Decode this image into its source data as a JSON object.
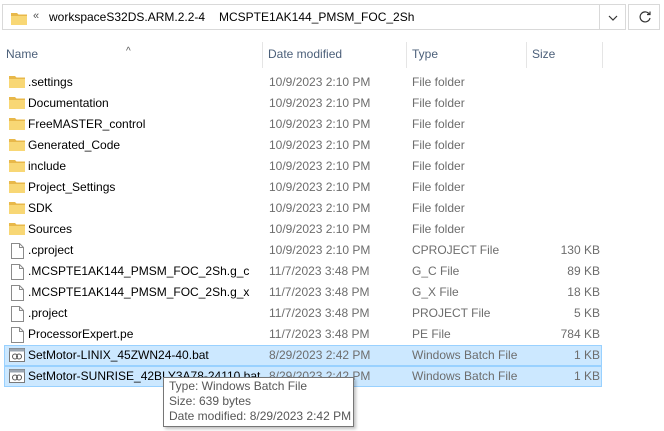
{
  "address_bar": {
    "chevron": "«",
    "segments": [
      "workspaceS32DS.ARM.2.2-4",
      "MCSPTE1AK144_PMSM_FOC_2Sh"
    ],
    "separator": "›"
  },
  "columns": {
    "name": "Name",
    "date": "Date modified",
    "type": "Type",
    "size": "Size",
    "sort_indicator": "^"
  },
  "files": [
    {
      "name": ".settings",
      "date": "10/9/2023 2:10 PM",
      "type": "File folder",
      "size": "",
      "icon": "folder-icon"
    },
    {
      "name": "Documentation",
      "date": "10/9/2023 2:10 PM",
      "type": "File folder",
      "size": "",
      "icon": "folder-icon"
    },
    {
      "name": "FreeMASTER_control",
      "date": "10/9/2023 2:10 PM",
      "type": "File folder",
      "size": "",
      "icon": "folder-icon"
    },
    {
      "name": "Generated_Code",
      "date": "10/9/2023 2:10 PM",
      "type": "File folder",
      "size": "",
      "icon": "folder-icon"
    },
    {
      "name": "include",
      "date": "10/9/2023 2:10 PM",
      "type": "File folder",
      "size": "",
      "icon": "folder-icon"
    },
    {
      "name": "Project_Settings",
      "date": "10/9/2023 2:10 PM",
      "type": "File folder",
      "size": "",
      "icon": "folder-icon"
    },
    {
      "name": "SDK",
      "date": "10/9/2023 2:10 PM",
      "type": "File folder",
      "size": "",
      "icon": "folder-icon"
    },
    {
      "name": "Sources",
      "date": "10/9/2023 2:10 PM",
      "type": "File folder",
      "size": "",
      "icon": "folder-icon"
    },
    {
      "name": ".cproject",
      "date": "10/9/2023 2:10 PM",
      "type": "CPROJECT File",
      "size": "130 KB",
      "icon": "file-icon"
    },
    {
      "name": ".MCSPTE1AK144_PMSM_FOC_2Sh.g_c",
      "date": "11/7/2023 3:48 PM",
      "type": "G_C File",
      "size": "89 KB",
      "icon": "file-icon"
    },
    {
      "name": ".MCSPTE1AK144_PMSM_FOC_2Sh.g_x",
      "date": "11/7/2023 3:48 PM",
      "type": "G_X File",
      "size": "18 KB",
      "icon": "file-icon"
    },
    {
      "name": ".project",
      "date": "11/7/2023 3:48 PM",
      "type": "PROJECT File",
      "size": "5 KB",
      "icon": "file-icon"
    },
    {
      "name": "ProcessorExpert.pe",
      "date": "11/7/2023 3:48 PM",
      "type": "PE File",
      "size": "784 KB",
      "icon": "file-icon"
    },
    {
      "name": "SetMotor-LINIX_45ZWN24-40.bat",
      "date": "8/29/2023 2:42 PM",
      "type": "Windows Batch File",
      "size": "1 KB",
      "icon": "batch-file-icon",
      "state": "selected"
    },
    {
      "name": "SetMotor-SUNRISE_42BLY3A78-24110.bat",
      "date": "8/29/2023 2:42 PM",
      "type": "Windows Batch File",
      "size": "1 KB",
      "icon": "batch-file-icon",
      "state": "selected"
    }
  ],
  "tooltip": {
    "type_line": "Type: Windows Batch File",
    "size_line": "Size: 639 bytes",
    "date_line": "Date modified: 8/29/2023 2:42 PM"
  },
  "colors": {
    "selection": "#cce8ff",
    "selection_border": "#99d1ff",
    "folder": "#f8d775",
    "header_text": "#4c607a"
  }
}
